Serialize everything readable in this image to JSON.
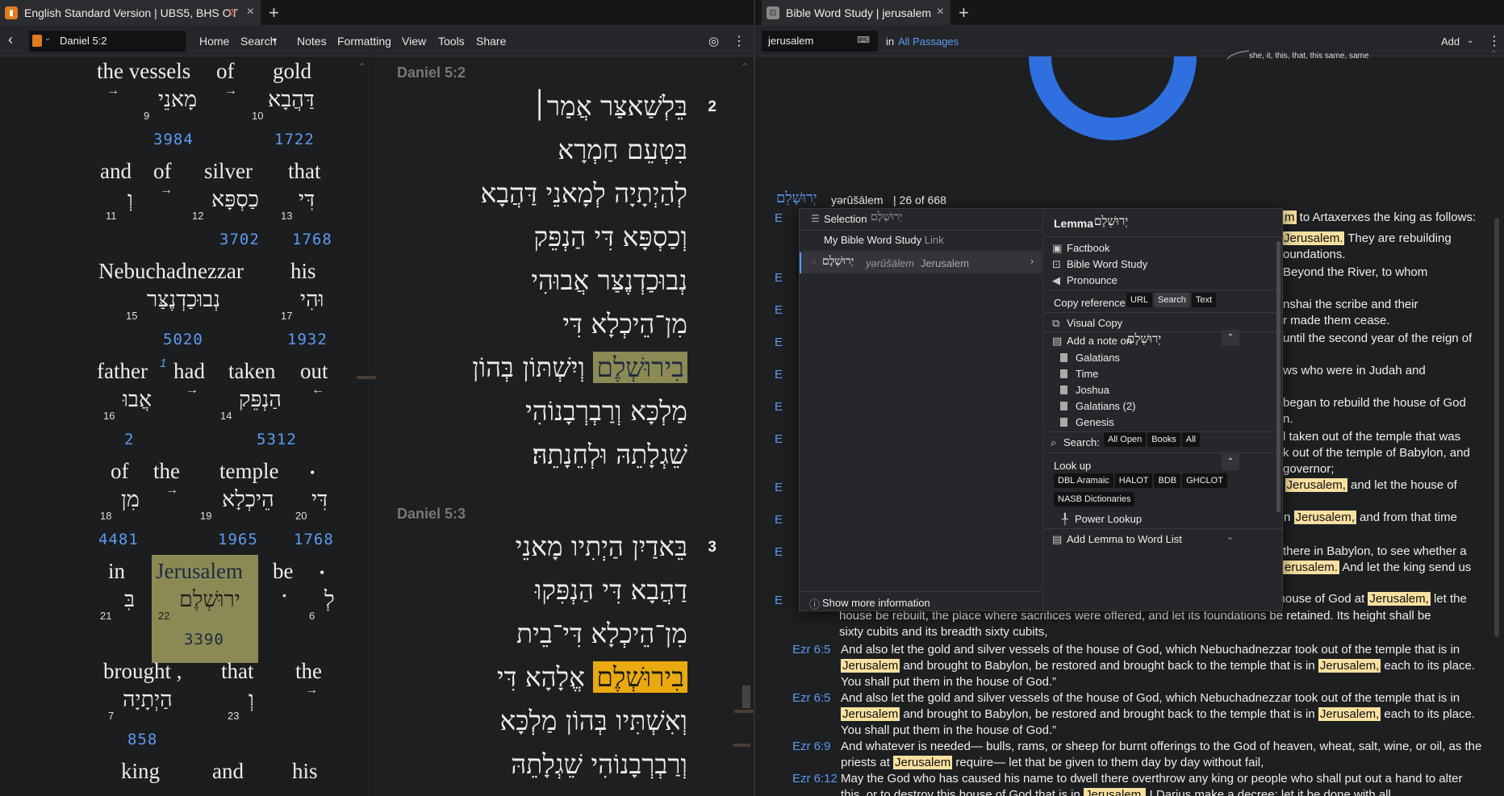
{
  "left": {
    "tab_title": "English Standard Version | UBS5, BHS OT",
    "nav_ref": "Daniel 5:2",
    "menu": [
      "Home",
      "Search",
      "Notes",
      "Formatting",
      "View",
      "Tools",
      "Share"
    ],
    "interlinear": [
      {
        "en": "the vessels",
        "en2": "of",
        "en3": "gold"
      },
      {
        "heb1": "מָאנֵי",
        "heb2": "דַּהֲבָא",
        "n1": "9",
        "n2": "10",
        "s1": "3984",
        "s2": "1722"
      },
      {
        "en": "and",
        "en2": "of",
        "en3": "silver",
        "en4": "that"
      },
      {
        "heb1": "וְ",
        "heb2": "כַסְפָּא",
        "heb3": "דִּי",
        "n1": "11",
        "n2": "12",
        "n3": "13",
        "s2": "3702",
        "s3": "1768"
      },
      {
        "en": "Nebuchadnezzar",
        "en2": "his"
      },
      {
        "heb1": "נְבוּכַדְנֶצַּר",
        "heb2": "וּהִי",
        "n1": "15",
        "n2": "17",
        "s1": "5020",
        "s2": "1932"
      },
      {
        "en": "father",
        "sup": "1",
        "en2": "had",
        "en3": "taken",
        "en4": "out"
      },
      {
        "heb1": "אֲבוּ",
        "heb2": "הַנְפֵּק",
        "n1": "16",
        "n2": "14",
        "s1": "2",
        "s2": "5312"
      },
      {
        "en": "of",
        "en2": "the",
        "en3": "temple",
        "en4": "•"
      },
      {
        "heb1": "מִן",
        "heb2": "הֵיכְלָא",
        "heb3": "דִּי",
        "n1": "18",
        "n2": "19",
        "n3": "20",
        "s1": "4481",
        "s2": "1965",
        "s3": "1768"
      },
      {
        "en": "in",
        "en2": "Jerusalem",
        "en3": "be",
        "en4": "•"
      },
      {
        "heb1": "בִּ",
        "heb2": "ירוּשְׁלֶם",
        "heb3": "לְ",
        "n1": "21",
        "n2": "22",
        "n3": "6",
        "s2": "3390"
      },
      {
        "en": "brought ,",
        "en2": "that",
        "en3": "the"
      },
      {
        "heb1": "הַיְתָיָה",
        "heb2": "וְ",
        "n1": "7",
        "n2": "23",
        "s1": "858"
      },
      {
        "en": "king",
        "en2": "and",
        "en3": "his"
      }
    ],
    "heb_v2_head": "Daniel 5:2",
    "heb_v2_num": "2",
    "heb_v2": [
      "בֵּלְשַׁאצַּר אֲמַר׀",
      "בִּטְעֵם חַמְרָא",
      "לְהַיְתָיָה לְמָאנֵי דַּהֲבָא",
      "וְכַסְפָּא דִּי הַנְפֵּק",
      "נְבוּכַדְנֶצַּר אֲבוּהִי",
      "מִן־הֵיכְלָא דִּי",
      "וְיִשְׁתּוֹן בְּהוֹן",
      "מַלְכָּא וְרַבְרְבָנוֹהִי",
      "שֵׁגְלָתֵהּ וּלְחֵנָתֵהּ׃"
    ],
    "heb_v2_hl": "בִירוּשְׁלֶם",
    "heb_v3_head": "Daniel 5:3",
    "heb_v3_num": "3",
    "heb_v3": [
      "בֵּאדַיִן הַיְתִיו מָאנֵי",
      "דַהֲבָא דִּי הַנְפִּקוּ",
      "מִן־הֵיכְלָא דִּי־בֵית",
      "אֱלָהָא דִּי",
      "וְאִשְׁתִּיו בְּהוֹן מַלְכָּא",
      "וְרַבְרְבָנוֹהִי שֵׁגְלָתֵהּ"
    ],
    "heb_v3_hl": "בִירוּשְׁלֶם"
  },
  "right": {
    "tab_title": "Bible Word Study | jerusalem",
    "search_value": "jerusalem",
    "in_label": "in",
    "scope": "All Passages",
    "add_label": "Add",
    "chart_caption": "she, it, this, that, this same, same",
    "lemma_heb": "יְרוּשָׁלֵם",
    "lemma_translit": "yərûšālem",
    "lemma_count": "26 of 668",
    "results": [
      {
        "ref": "Ezr 6:5",
        "text": "And also let the gold and silver vessels of the house of God, which Nebuchadnezzar took out of the temple that is in ",
        "hl": "Jerusalem",
        "after": " and brought to Babylon, be restored and brought back to the temple that is in ",
        "hl2": "Jerusalem,",
        "after2": " each to its place. You shall put them in the house of God.”"
      },
      {
        "ref": "Ezr 6:5",
        "text": "And also let the gold and silver vessels of the house of God, which Nebuchadnezzar took out of the temple that is in ",
        "hl": "Jerusalem",
        "after": " and brought to Babylon, be restored and brought back to the temple that is in ",
        "hl2": "Jerusalem,",
        "after2": " each to its place. You shall put them in the house of God.”"
      },
      {
        "ref": "Ezr 6:9",
        "text": "And whatever is needed— bulls, rams, or sheep for burnt offerings to the God of heaven, wheat, salt, wine, or oil, as the priests at ",
        "hl": "Jerusalem",
        "after": " require— let that be given to them day by day without fail,",
        "hl2": "",
        "after2": ""
      },
      {
        "ref": "Ezr 6:12",
        "text": "May the God who has caused his name to dwell there overthrow any king or people who shall put out a hand to alter this, or to destroy this house of God that is in ",
        "hl": "Jerusalem.",
        "after": " I Darius make a decree; let it be done with all",
        "hl2": "",
        "after2": ""
      }
    ],
    "partial_lines": [
      {
        "hl": "m",
        "text": " to Artaxerxes the king as follows:"
      },
      {
        "pre": "",
        "hl": "Jerusalem.",
        "text": " They are rebuilding"
      },
      {
        "text": "oundations."
      },
      {
        "text": "Beyond the River, to whom"
      },
      {
        "text": "nshai the scribe and their"
      },
      {
        "text": "r made them cease."
      },
      {
        "text": "until the second year of the reign of"
      },
      {
        "text": "ws who were in Judah and"
      },
      {
        "text": "began to rebuild the house of God"
      },
      {
        "text": "n."
      },
      {
        "text": "l taken out of the temple that was"
      },
      {
        "text": "k out of the temple of Babylon, and"
      },
      {
        "text": "governor;"
      },
      {
        "pre": "n ",
        "hl": "Jerusalem,",
        "text": " and let the house of"
      },
      {
        "pre": "s in ",
        "hl": "Jerusalem,",
        "text": " and from that time"
      },
      {
        "text": "there in Babylon, to see whether a"
      },
      {
        "hl": "erusalem.",
        "text": " And let the king send us"
      }
    ],
    "ezr_line": {
      "pre": "e house of God at ",
      "hl": "Jerusalem,",
      "post": " let the"
    },
    "ezr_cont": [
      "house be rebuilt, the place where sacrifices were offered, and let its foundations be retained. Its height shall be",
      "sixty cubits and its breadth sixty cubits,"
    ]
  },
  "menu": {
    "selection_label": "Selection",
    "selection_heb": "יְרוּשְׁלֶם",
    "my_study": "My Bible Word Study",
    "my_study_link": "Link",
    "lemma_item_heb": "יְרוּשְׁלֶם",
    "lemma_item_translit": "yərûšālem",
    "lemma_item_gloss": "Jerusalem",
    "show_more": "Show more information",
    "lemma_label": "Lemma",
    "lemma_heb": "יְרוּשְׁלֶם",
    "factbook": "Factbook",
    "bws": "Bible Word Study",
    "pronounce": "Pronounce",
    "copy_ref": "Copy reference:",
    "copy_opts": [
      "URL",
      "Search",
      "Text"
    ],
    "visual_copy": "Visual Copy",
    "add_note": "Add a note on",
    "add_note_heb": "יְרוּשְׁלֶם",
    "notes": [
      "Galatians",
      "Time",
      "Joshua",
      "Galatians (2)",
      "Genesis"
    ],
    "search_label": "Search:",
    "search_opts": [
      "All Open",
      "Books",
      "All"
    ],
    "lookup": "Look up",
    "lookup_opts": [
      "DBL Aramaic",
      "HALOT",
      "BDB",
      "GHCLOT",
      "NASB Dictionaries"
    ],
    "power_lookup": "Power Lookup",
    "add_lemma": "Add Lemma to Word List"
  },
  "colors": {
    "accent": "#5b9bf0",
    "olive": "#8b8a55",
    "gold": "#e9a90f",
    "hl": "#f7e0a0",
    "ring": "#2f6fe0"
  }
}
